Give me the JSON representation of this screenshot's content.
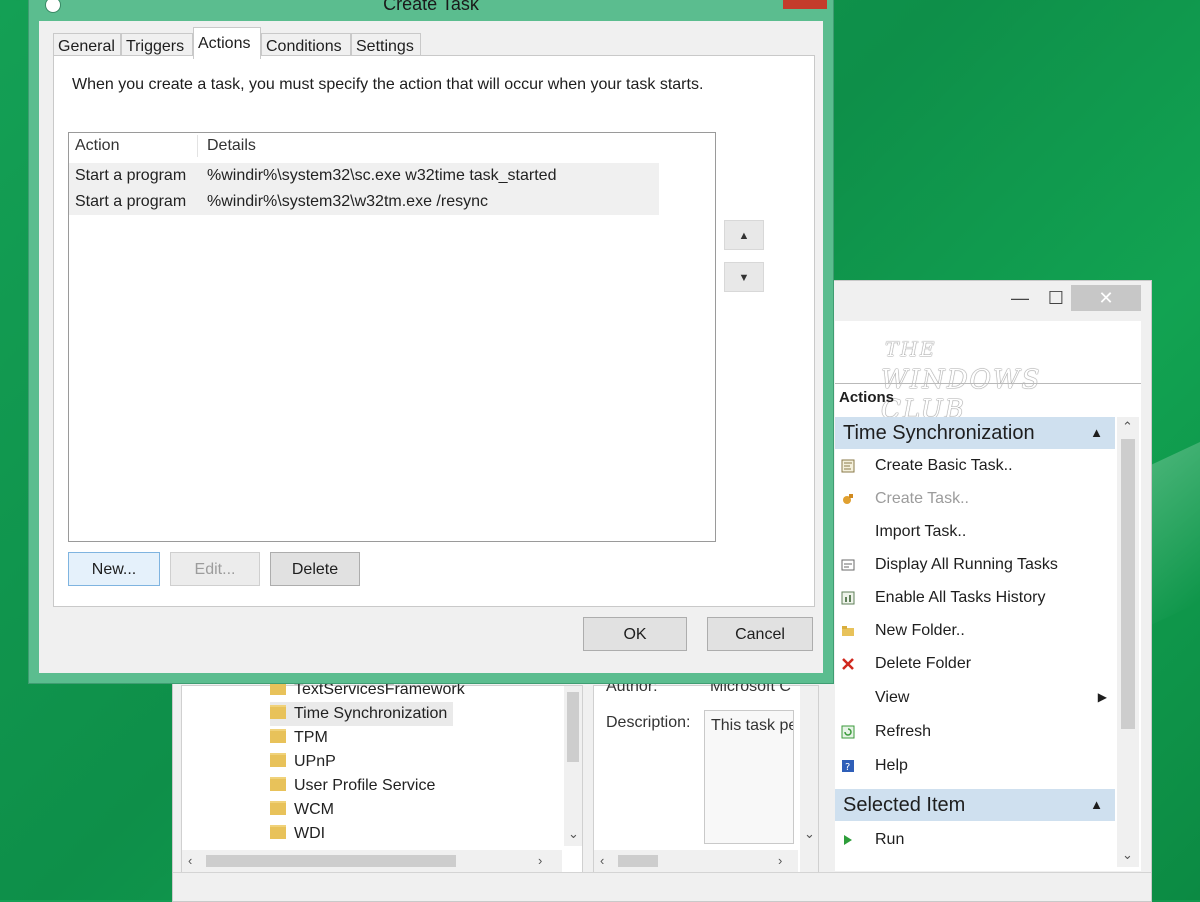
{
  "dialog": {
    "title": "Create Task",
    "tabs": [
      {
        "label": "General"
      },
      {
        "label": "Triggers"
      },
      {
        "label": "Actions"
      },
      {
        "label": "Conditions"
      },
      {
        "label": "Settings"
      }
    ],
    "active_tab": "Actions",
    "intro": "When you create a task, you must specify the action that will occur when your task starts.",
    "columns": {
      "action": "Action",
      "details": "Details"
    },
    "rows": [
      {
        "action": "Start a program",
        "details": "%windir%\\system32\\sc.exe w32time task_started"
      },
      {
        "action": "Start a program",
        "details": "%windir%\\system32\\w32tm.exe /resync"
      }
    ],
    "move_up": "▲",
    "move_down": "▼",
    "buttons": {
      "new": "New...",
      "edit": "Edit...",
      "delete": "Delete",
      "ok": "OK",
      "cancel": "Cancel"
    }
  },
  "background": {
    "window_controls": {
      "minimize": "—",
      "maximize": "☐",
      "close": "✕"
    },
    "tree": {
      "items": [
        {
          "label": "TextServicesFramework"
        },
        {
          "label": "Time Synchronization"
        },
        {
          "label": "TPM"
        },
        {
          "label": "UPnP"
        },
        {
          "label": "User Profile Service"
        },
        {
          "label": "WCM"
        },
        {
          "label": "WDI"
        }
      ],
      "selected": "Time Synchronization"
    },
    "details": {
      "author_label": "Author:",
      "author_value": "Microsoft C",
      "description_label": "Description:",
      "description_value": "This task pe"
    },
    "logo": {
      "line1": "THE",
      "line2": "WINDOWS CLUB"
    },
    "actions_pane": {
      "title": "Actions",
      "section1": "Time Synchronization",
      "items": [
        {
          "label": "Create Basic Task..",
          "icon": "wizard-icon"
        },
        {
          "label": "Create Task..",
          "icon": "task-icon"
        },
        {
          "label": "Import Task..",
          "icon": ""
        },
        {
          "label": "Display All Running Tasks",
          "icon": "running-tasks-icon"
        },
        {
          "label": "Enable All Tasks History",
          "icon": "history-icon"
        },
        {
          "label": "New Folder..",
          "icon": "folder-icon"
        },
        {
          "label": "Delete Folder",
          "icon": "delete-icon"
        },
        {
          "label": "View",
          "icon": ""
        },
        {
          "label": "Refresh",
          "icon": "refresh-icon"
        },
        {
          "label": "Help",
          "icon": "help-icon"
        }
      ],
      "section2": "Selected Item",
      "selected_items": [
        {
          "label": "Run",
          "icon": "run-icon"
        }
      ]
    },
    "colors": {
      "section_header": "#cfe0ef",
      "desktop": "#0e8f49",
      "dialog_frame": "#5bbd8f"
    }
  }
}
